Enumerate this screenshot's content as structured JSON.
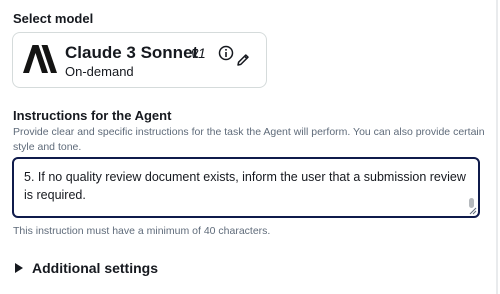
{
  "model": {
    "section_label": "Select model",
    "name": "Claude 3 Sonnet",
    "version": "v1",
    "mode": "On-demand"
  },
  "instructions": {
    "label": "Instructions for the Agent",
    "description": "Provide clear and specific instructions for the task the Agent will perform. You can also provide certain style and tone.",
    "value": "5. If no quality review document exists, inform the user that a submission review is required.",
    "constraint": "This instruction must have a minimum of 40 characters."
  },
  "additional_settings": {
    "label": "Additional settings"
  },
  "icons": {
    "brand": "anthropic-logo-icon",
    "info": "info-icon",
    "edit": "pencil-icon",
    "expand": "caret-right-icon"
  }
}
